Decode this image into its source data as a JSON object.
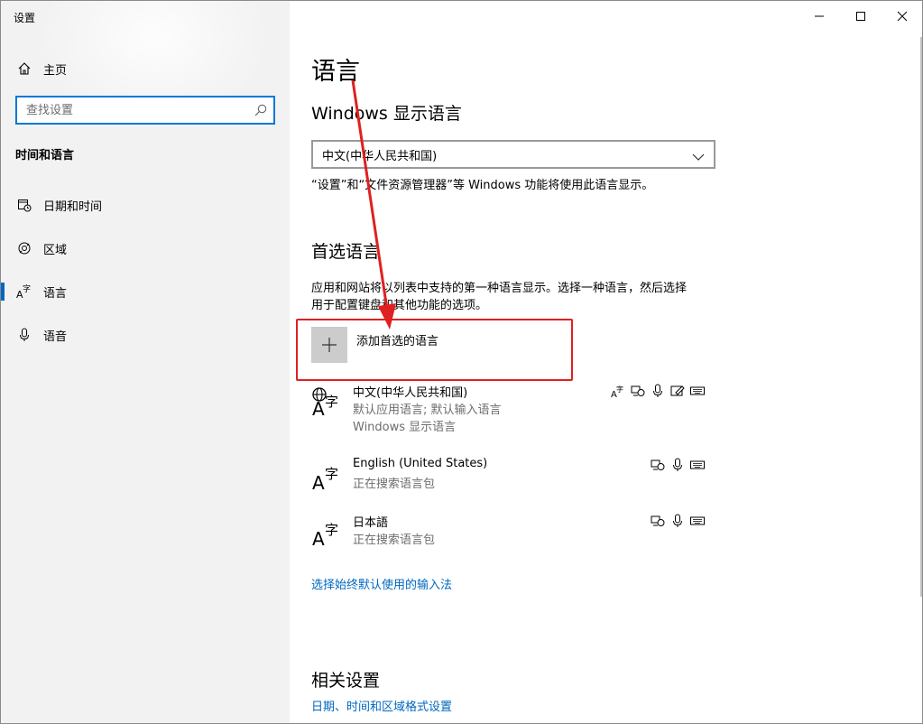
{
  "window": {
    "title": "设置"
  },
  "sidebar": {
    "home_label": "主页",
    "search_placeholder": "查找设置",
    "section_title": "时间和语言",
    "items": [
      {
        "label": "日期和时间",
        "icon": "calendar-clock-icon",
        "active": false
      },
      {
        "label": "区域",
        "icon": "region-globe-icon",
        "active": false
      },
      {
        "label": "语言",
        "icon": "language-icon",
        "active": true
      },
      {
        "label": "语音",
        "icon": "microphone-icon",
        "active": false
      }
    ]
  },
  "main": {
    "title": "语言",
    "display_language": {
      "heading": "Windows 显示语言",
      "selected": "中文(中华人民共和国)",
      "description": "“设置”和“文件资源管理器”等 Windows 功能将使用此语言显示。"
    },
    "preferred": {
      "heading": "首选语言",
      "description_line1": "应用和网站将以列表中支持的第一种语言显示。选择一种语言，然后选择",
      "description_line2": "用于配置键盘和其他功能的选项。",
      "add_label": "添加首选的语言",
      "languages": [
        {
          "name": "中文(中华人民共和国)",
          "sub1": "默认应用语言; 默认输入语言",
          "sub2": "Windows 显示语言",
          "features": [
            "display-language-icon",
            "speech-icon",
            "microphone-icon",
            "handwriting-icon",
            "keyboard-icon"
          ]
        },
        {
          "name": "English (United States)",
          "sub1": "正在搜索语言包",
          "features": [
            "speech-icon",
            "microphone-icon",
            "keyboard-icon"
          ]
        },
        {
          "name": "日本語",
          "sub1": "正在搜索语言包",
          "features": [
            "speech-icon",
            "microphone-icon",
            "keyboard-icon"
          ]
        }
      ],
      "input_method_link": "选择始终默认使用的输入法"
    },
    "related": {
      "heading": "相关设置",
      "link": "日期、时间和区域格式设置"
    }
  },
  "colors": {
    "accent": "#0067c0",
    "highlight": "#e02020",
    "sidebar_bg": "#f2f2f2"
  }
}
